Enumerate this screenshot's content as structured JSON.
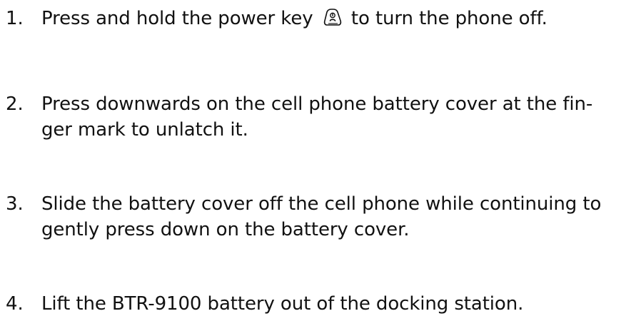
{
  "steps": [
    {
      "number": "1.",
      "text_before_icon": "Press and hold the power key",
      "icon": "power-key-icon",
      "text_after_icon": "to turn the phone off."
    },
    {
      "number": "2.",
      "line1": "Press downwards on the cell phone battery cover at the fin-",
      "line2": "ger mark to unlatch it."
    },
    {
      "number": "3.",
      "line1": "Slide the battery cover off the cell phone while continuing to",
      "line2": "gently press down on the battery cover."
    },
    {
      "number": "4.",
      "line1": "Lift the BTR-9100 battery out of the docking station."
    }
  ]
}
